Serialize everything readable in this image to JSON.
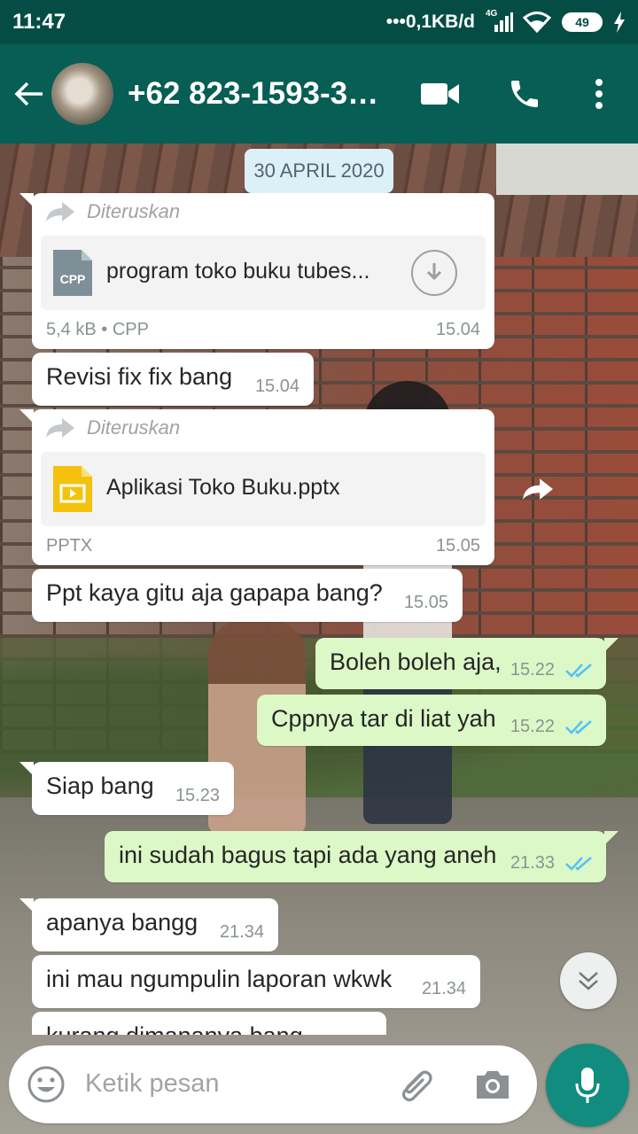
{
  "status_bar": {
    "time": "11:47",
    "network_speed": "0,1KB/d",
    "network_type": "4G",
    "battery": "49"
  },
  "header": {
    "contact": "+62 823-1593-32…",
    "icons": [
      "back-arrow-icon",
      "video-call-icon",
      "phone-icon",
      "more-icon"
    ]
  },
  "chat": {
    "date": "30 APRIL 2020",
    "forward_label": "Diteruskan",
    "messages": [
      {
        "type": "file",
        "dir": "in",
        "file_icon": "CPP",
        "file_name": "program toko buku tubes...",
        "meta": "5,4 kB • CPP",
        "time": "15.04"
      },
      {
        "type": "text",
        "dir": "in",
        "text": "Revisi fix fix bang",
        "time": "15.04"
      },
      {
        "type": "file",
        "dir": "in",
        "file_icon": "slides",
        "file_name": "Aplikasi Toko Buku.pptx",
        "meta": "PPTX",
        "time": "15.05"
      },
      {
        "type": "text",
        "dir": "in",
        "text": "Ppt kaya gitu aja gapapa bang?",
        "time": "15.05"
      },
      {
        "type": "text",
        "dir": "out",
        "text": "Boleh boleh aja,",
        "time": "15.22"
      },
      {
        "type": "text",
        "dir": "out",
        "text": "Cppnya tar di liat yah",
        "time": "15.22"
      },
      {
        "type": "text",
        "dir": "in",
        "text": "Siap bang",
        "time": "15.23"
      },
      {
        "type": "text",
        "dir": "out",
        "text": "ini sudah bagus tapi ada yang aneh",
        "time": "21.33"
      },
      {
        "type": "text",
        "dir": "in",
        "text": "apanya bangg",
        "time": "21.34"
      },
      {
        "type": "text",
        "dir": "in",
        "text": "ini mau ngumpulin laporan wkwk",
        "time": "21.34"
      },
      {
        "type": "text",
        "dir": "in",
        "text": "kurang dimananya bang",
        "time": ""
      }
    ]
  },
  "input": {
    "placeholder": "Ketik pesan"
  },
  "colors": {
    "header": "#075e54",
    "status_bar": "#054d44",
    "outgoing_bubble": "#dcf8c6",
    "incoming_bubble": "#ffffff",
    "mic_button": "#128c7e",
    "read_ticks": "#4fc3f7"
  }
}
